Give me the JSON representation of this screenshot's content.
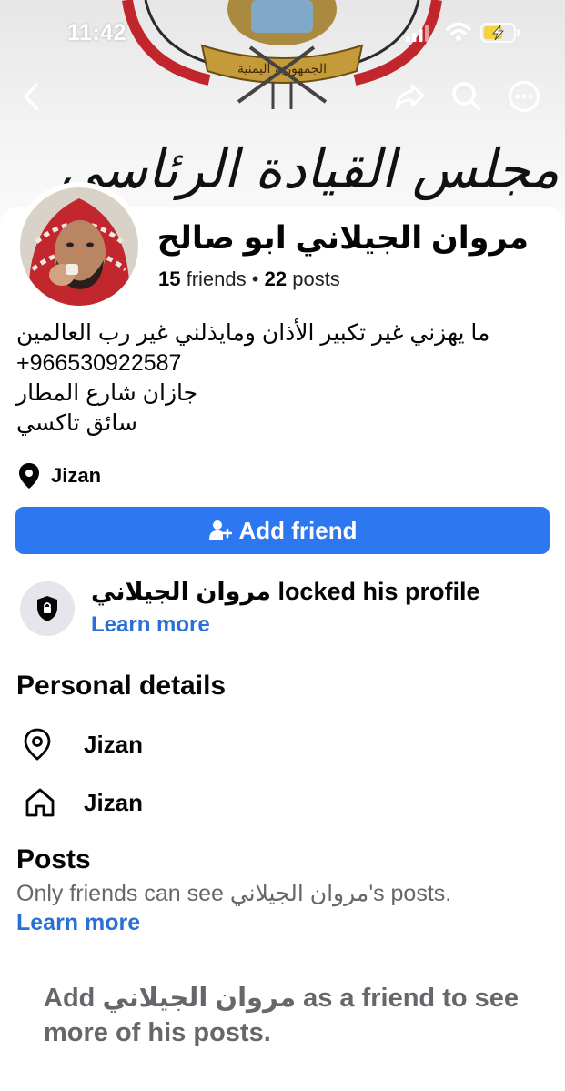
{
  "status_bar": {
    "time": "11:42"
  },
  "cover": {
    "calligraphy": "مجلس القيادة الرئاسي",
    "emblem_text": "الجمهورية اليمنية"
  },
  "profile": {
    "name": "مروان الجيلاني ابو صالح",
    "friends_count": "15",
    "friends_label": "friends",
    "separator": "•",
    "posts_count": "22",
    "posts_label": "posts"
  },
  "bio": [
    "ما يهزني غير تكبير الأذان ومايذلني غير رب العالمين",
    "+966530922587",
    "جازان شارع المطار",
    "سائق تاكسي"
  ],
  "location": "Jizan",
  "add_friend": {
    "label": "Add friend"
  },
  "locked": {
    "text": "مروان الجيلاني locked his profile",
    "learn_more": "Learn more"
  },
  "personal_details": {
    "title": "Personal details",
    "items": [
      {
        "icon": "location-pin-icon",
        "text": "Jizan"
      },
      {
        "icon": "home-icon",
        "text": "Jizan"
      }
    ]
  },
  "posts": {
    "title": "Posts",
    "subtitle": "Only friends can see مروان الجيلاني's posts.",
    "learn_more": "Learn more",
    "add_note": "Add مروان الجيلاني as a friend to see more of his posts."
  },
  "colors": {
    "accent": "#2d77f0",
    "link": "#2a6fd6",
    "muted": "#65676b",
    "icon_bg": "#e4e6eb"
  }
}
